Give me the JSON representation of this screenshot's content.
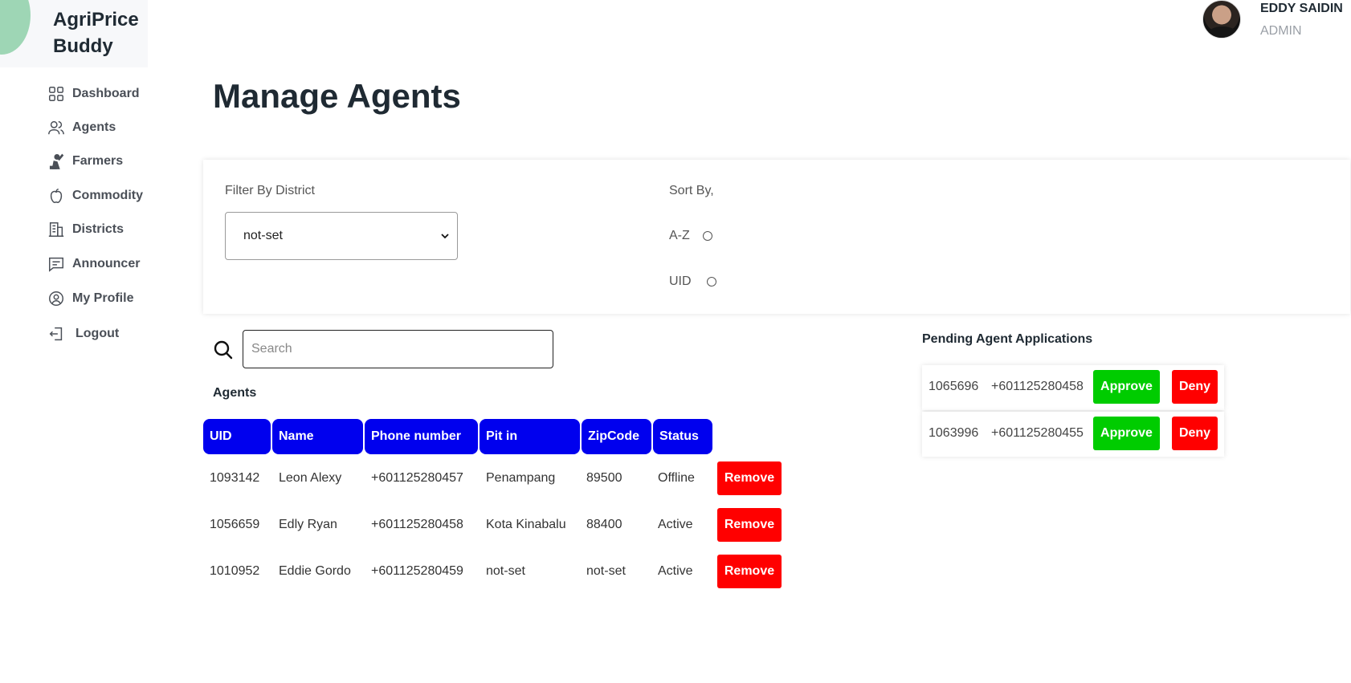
{
  "app": {
    "name_line1": "AgriPrice",
    "name_line2": "Buddy"
  },
  "user": {
    "name": "EDDY SAIDIN",
    "role": "ADMIN"
  },
  "sidebar": {
    "items": [
      {
        "label": "Dashboard",
        "icon": "grid-icon"
      },
      {
        "label": "Agents",
        "icon": "users-icon"
      },
      {
        "label": "Farmers",
        "icon": "farmer-icon"
      },
      {
        "label": "Commodity",
        "icon": "apple-icon"
      },
      {
        "label": "Districts",
        "icon": "building-icon"
      },
      {
        "label": "Announcer",
        "icon": "message-icon"
      },
      {
        "label": "My Profile",
        "icon": "profile-icon"
      },
      {
        "label": "Logout",
        "icon": "logout-icon"
      }
    ]
  },
  "page": {
    "title": "Manage Agents"
  },
  "filter": {
    "district_label": "Filter By District",
    "district_value": "not-set",
    "sort_label": "Sort By,",
    "sort_options": [
      "A-Z",
      "UID"
    ]
  },
  "search": {
    "placeholder": "Search"
  },
  "agents": {
    "heading": "Agents",
    "columns": [
      "UID",
      "Name",
      "Phone number",
      "Pit in",
      "ZipCode",
      "Status"
    ],
    "rows": [
      {
        "uid": "1093142",
        "name": "Leon Alexy",
        "phone": "+601125280457",
        "pit_in": "Penampang",
        "zipcode": "89500",
        "status": "Offline",
        "action": "Remove"
      },
      {
        "uid": "1056659",
        "name": "Edly Ryan",
        "phone": "+601125280458",
        "pit_in": "Kota Kinabalu",
        "zipcode": "88400",
        "status": "Active",
        "action": "Remove"
      },
      {
        "uid": "1010952",
        "name": "Eddie Gordo",
        "phone": "+601125280459",
        "pit_in": "not-set",
        "zipcode": "not-set",
        "status": "Active",
        "action": "Remove"
      }
    ]
  },
  "pending": {
    "heading": "Pending Agent Applications",
    "items": [
      {
        "uid": "1065696",
        "phone": "+601125280458",
        "approve": "Approve",
        "deny": "Deny"
      },
      {
        "uid": "1063996",
        "phone": "+601125280455",
        "approve": "Approve",
        "deny": "Deny"
      }
    ]
  },
  "colors": {
    "table_header": "#0000ee",
    "remove": "#ff0000",
    "approve": "#00cc00",
    "deny": "#ff0000",
    "brand_circle": "#9ed6b5"
  }
}
